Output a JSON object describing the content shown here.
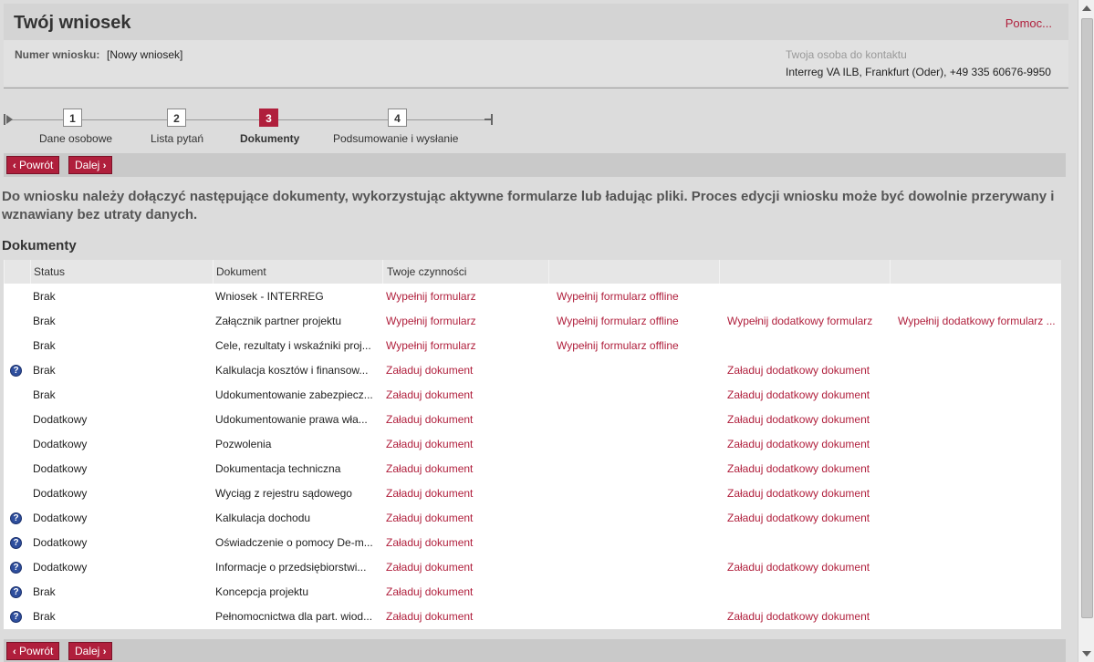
{
  "header": {
    "title": "Twój wniosek",
    "help_link": "Pomoc...",
    "number_label": "Numer wniosku:",
    "number_value": "[Nowy wniosek]",
    "contact_label": "Twoja osoba do kontaktu",
    "contact_value": "Interreg VA ILB, Frankfurt (Oder), +49 335 60676-9950"
  },
  "stepper": {
    "steps": [
      {
        "number": "1",
        "label": "Dane osobowe",
        "active": false
      },
      {
        "number": "2",
        "label": "Lista pytań",
        "active": false
      },
      {
        "number": "3",
        "label": "Dokumenty",
        "active": true
      },
      {
        "number": "4",
        "label": "Podsumowanie i wysłanie",
        "active": false
      }
    ]
  },
  "nav": {
    "back_label": "Powrót",
    "next_label": "Dalej"
  },
  "intro": "Do wniosku należy dołączyć następujące dokumenty, wykorzystując aktywne formularze lub ładując pliki. Proces edycji wniosku może być dowolnie przerywany i wznawiany bez utraty danych.",
  "section_title": "Dokumenty",
  "table": {
    "headers": [
      "Status",
      "Dokument",
      "Twoje czynności",
      "",
      "",
      ""
    ],
    "rows": [
      {
        "help": false,
        "status": "Brak",
        "document": "Wniosek - INTERREG",
        "a1": "Wypełnij formularz",
        "a2": "Wypełnij formularz offline",
        "a3": "",
        "a4": ""
      },
      {
        "help": false,
        "status": "Brak",
        "document": "Załącznik partner projektu",
        "a1": "Wypełnij formularz",
        "a2": "Wypełnij formularz offline",
        "a3": "Wypełnij dodatkowy formularz",
        "a4": "Wypełnij dodatkowy formularz ..."
      },
      {
        "help": false,
        "status": "Brak",
        "document": "Cele, rezultaty i wskaźniki proj...",
        "a1": "Wypełnij formularz",
        "a2": "Wypełnij formularz offline",
        "a3": "",
        "a4": ""
      },
      {
        "help": true,
        "status": "Brak",
        "document": "Kalkulacja kosztów i finansow...",
        "a1": "Załaduj dokument",
        "a2": "",
        "a3": "Załaduj dodatkowy dokument",
        "a4": ""
      },
      {
        "help": false,
        "status": "Brak",
        "document": "Udokumentowanie zabezpiecz...",
        "a1": "Załaduj dokument",
        "a2": "",
        "a3": "Załaduj dodatkowy dokument",
        "a4": ""
      },
      {
        "help": false,
        "status": "Dodatkowy",
        "document": "Udokumentowanie prawa wła...",
        "a1": "Załaduj dokument",
        "a2": "",
        "a3": "Załaduj dodatkowy dokument",
        "a4": ""
      },
      {
        "help": false,
        "status": "Dodatkowy",
        "document": "Pozwolenia",
        "a1": "Załaduj dokument",
        "a2": "",
        "a3": "Załaduj dodatkowy dokument",
        "a4": ""
      },
      {
        "help": false,
        "status": "Dodatkowy",
        "document": "Dokumentacja techniczna",
        "a1": "Załaduj dokument",
        "a2": "",
        "a3": "Załaduj dodatkowy dokument",
        "a4": ""
      },
      {
        "help": false,
        "status": "Dodatkowy",
        "document": "Wyciąg z rejestru sądowego",
        "a1": "Załaduj dokument",
        "a2": "",
        "a3": "Załaduj dodatkowy dokument",
        "a4": ""
      },
      {
        "help": true,
        "status": "Dodatkowy",
        "document": "Kalkulacja dochodu",
        "a1": "Załaduj dokument",
        "a2": "",
        "a3": "Załaduj dodatkowy dokument",
        "a4": ""
      },
      {
        "help": true,
        "status": "Dodatkowy",
        "document": "Oświadczenie o pomocy De-m...",
        "a1": "Załaduj dokument",
        "a2": "",
        "a3": "",
        "a4": ""
      },
      {
        "help": true,
        "status": "Dodatkowy",
        "document": "Informacje o przedsiębiorstwi...",
        "a1": "Załaduj dokument",
        "a2": "",
        "a3": "Załaduj dodatkowy dokument",
        "a4": ""
      },
      {
        "help": true,
        "status": "Brak",
        "document": "Koncepcja projektu",
        "a1": "Załaduj dokument",
        "a2": "",
        "a3": "",
        "a4": ""
      },
      {
        "help": true,
        "status": "Brak",
        "document": "Pełnomocnictwa dla part. wiod...",
        "a1": "Załaduj dokument",
        "a2": "",
        "a3": "Załaduj dodatkowy dokument",
        "a4": ""
      }
    ]
  },
  "icons": {
    "help": "question-circle-icon",
    "back": "chevron-left-icon",
    "next": "chevron-right-icon"
  },
  "colors": {
    "accent": "#b01f3c",
    "help_icon": "#2f4f9e"
  }
}
